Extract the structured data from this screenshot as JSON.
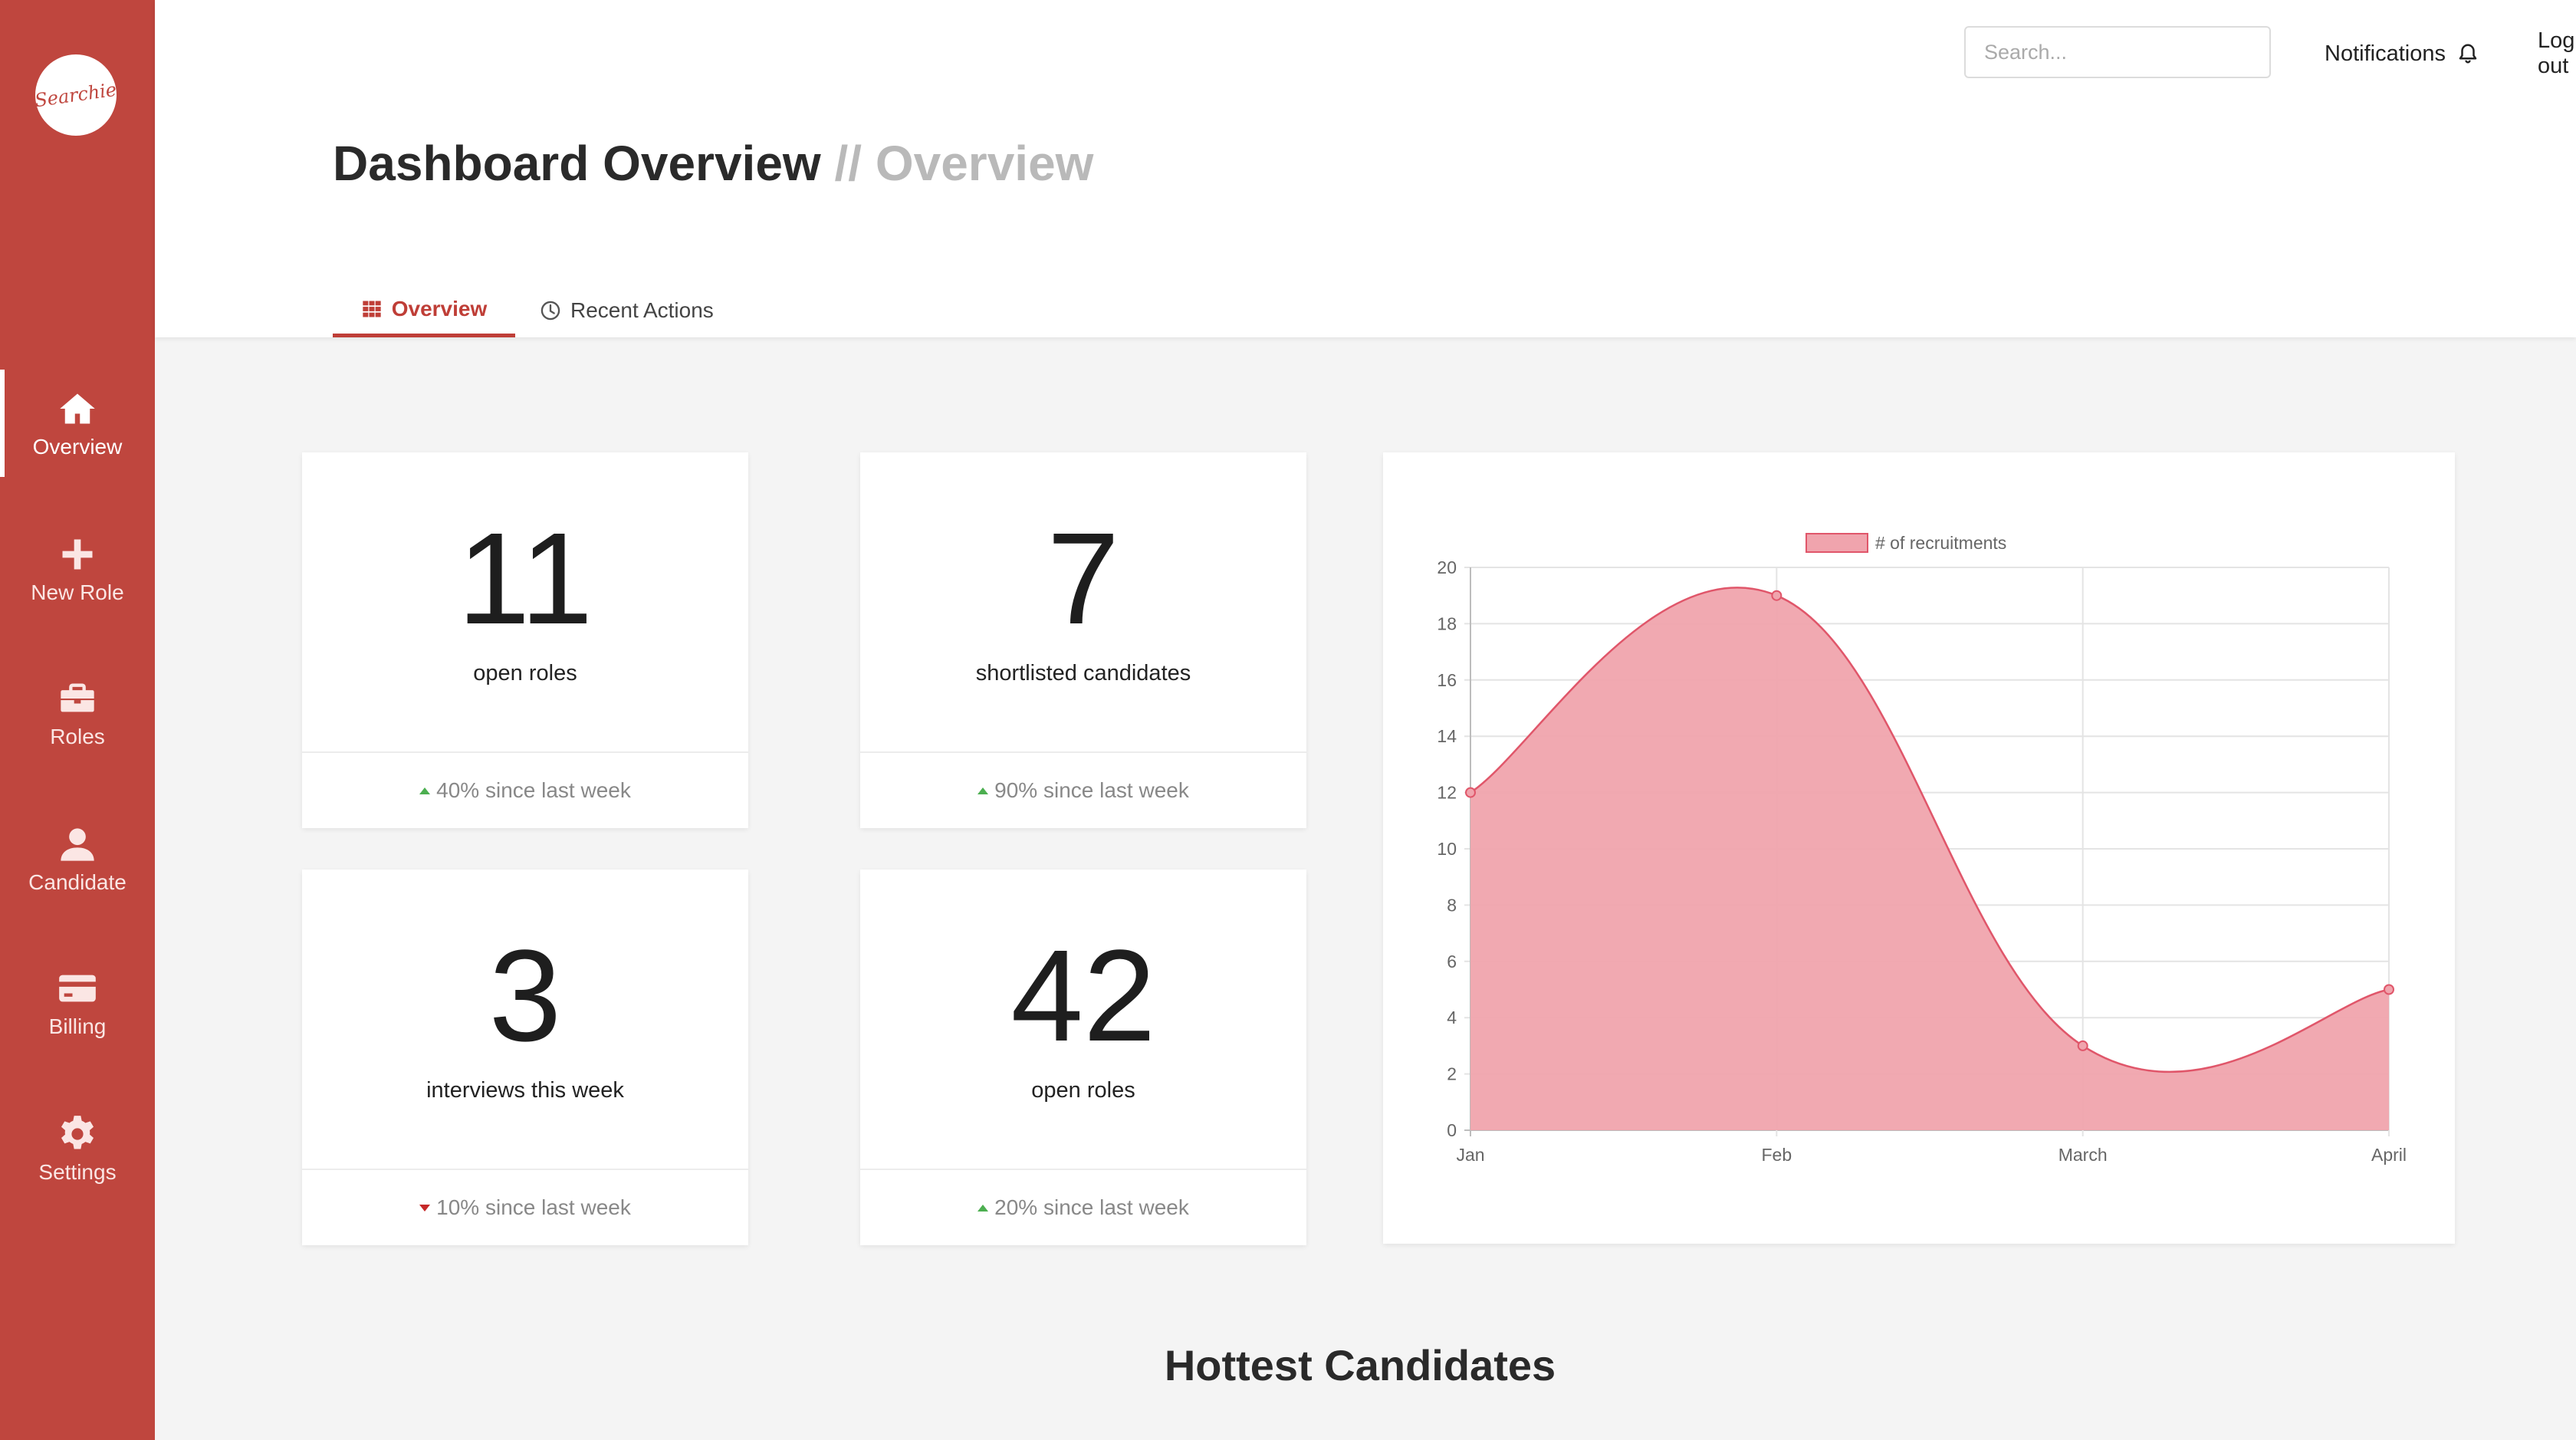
{
  "app": {
    "logo_text": "Searchie"
  },
  "sidebar": {
    "items": [
      {
        "label": "Overview",
        "icon": "home-icon",
        "active": true
      },
      {
        "label": "New Role",
        "icon": "plus-icon"
      },
      {
        "label": "Roles",
        "icon": "briefcase-icon"
      },
      {
        "label": "Candidate",
        "icon": "user-icon"
      },
      {
        "label": "Billing",
        "icon": "credit-card-icon"
      },
      {
        "label": "Settings",
        "icon": "gear-icon"
      }
    ]
  },
  "header": {
    "search_placeholder": "Search...",
    "notifications_label": "Notifications",
    "logout_label": "Log out",
    "title": "Dashboard Overview",
    "breadcrumb": "// Overview",
    "tabs": [
      {
        "label": "Overview",
        "icon": "grid-icon",
        "active": true
      },
      {
        "label": "Recent Actions",
        "icon": "clock-icon",
        "active": false
      }
    ]
  },
  "stats": [
    {
      "value": "11",
      "label": "open roles",
      "change": "40% since last week",
      "trend": "up"
    },
    {
      "value": "7",
      "label": "shortlisted candidates",
      "change": "90% since last week",
      "trend": "up"
    },
    {
      "value": "3",
      "label": "interviews this week",
      "change": "10% since last week",
      "trend": "down"
    },
    {
      "value": "42",
      "label": "open roles",
      "change": "20% since last week",
      "trend": "up"
    }
  ],
  "chart_data": {
    "type": "area",
    "categories": [
      "Jan",
      "Feb",
      "March",
      "April"
    ],
    "series": [
      {
        "name": "# of recruitments",
        "values": [
          12,
          19,
          3,
          5
        ]
      }
    ],
    "ylim": [
      0,
      20
    ],
    "yticks": [
      0,
      2,
      4,
      6,
      8,
      10,
      12,
      14,
      16,
      18,
      20
    ],
    "grid": true,
    "legend": "top-center",
    "colors": {
      "fill": "#f0a4ad",
      "line": "#e0566a"
    }
  },
  "section": {
    "title": "Hottest Candidates"
  },
  "colors": {
    "brand": "#bf463e",
    "accent": "#bf3e37"
  }
}
